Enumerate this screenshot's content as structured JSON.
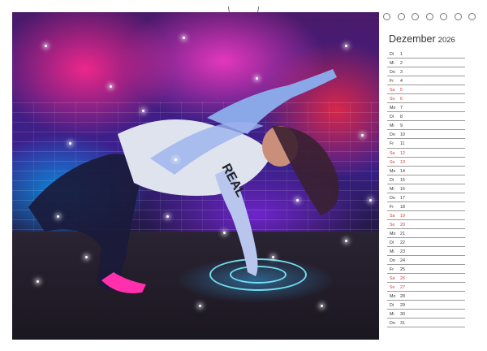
{
  "calendar": {
    "month": "Dezember",
    "year": "2026",
    "days": [
      {
        "wd": "Di",
        "d": "1",
        "weekend": false
      },
      {
        "wd": "Mi",
        "d": "2",
        "weekend": false
      },
      {
        "wd": "Do",
        "d": "3",
        "weekend": false
      },
      {
        "wd": "Fr",
        "d": "4",
        "weekend": false
      },
      {
        "wd": "Sa",
        "d": "5",
        "weekend": true
      },
      {
        "wd": "So",
        "d": "6",
        "weekend": true
      },
      {
        "wd": "Mo",
        "d": "7",
        "weekend": false
      },
      {
        "wd": "Di",
        "d": "8",
        "weekend": false
      },
      {
        "wd": "Mi",
        "d": "9",
        "weekend": false
      },
      {
        "wd": "Do",
        "d": "10",
        "weekend": false
      },
      {
        "wd": "Fr",
        "d": "11",
        "weekend": false
      },
      {
        "wd": "Sa",
        "d": "12",
        "weekend": true
      },
      {
        "wd": "So",
        "d": "13",
        "weekend": true
      },
      {
        "wd": "Mo",
        "d": "14",
        "weekend": false
      },
      {
        "wd": "Di",
        "d": "15",
        "weekend": false
      },
      {
        "wd": "Mi",
        "d": "16",
        "weekend": false
      },
      {
        "wd": "Do",
        "d": "17",
        "weekend": false
      },
      {
        "wd": "Fr",
        "d": "18",
        "weekend": false
      },
      {
        "wd": "Sa",
        "d": "19",
        "weekend": true
      },
      {
        "wd": "So",
        "d": "20",
        "weekend": true
      },
      {
        "wd": "Mo",
        "d": "21",
        "weekend": false
      },
      {
        "wd": "Di",
        "d": "22",
        "weekend": false
      },
      {
        "wd": "Mi",
        "d": "23",
        "weekend": false
      },
      {
        "wd": "Do",
        "d": "24",
        "weekend": false
      },
      {
        "wd": "Fr",
        "d": "25",
        "weekend": false
      },
      {
        "wd": "Sa",
        "d": "26",
        "weekend": true
      },
      {
        "wd": "So",
        "d": "27",
        "weekend": true
      },
      {
        "wd": "Mo",
        "d": "28",
        "weekend": false
      },
      {
        "wd": "Di",
        "d": "29",
        "weekend": false
      },
      {
        "wd": "Mi",
        "d": "30",
        "weekend": false
      },
      {
        "wd": "Do",
        "d": "31",
        "weekend": false
      }
    ]
  },
  "photo": {
    "shirt_lettering": "REAL"
  },
  "colors": {
    "weekend": "#d23b3b",
    "text": "#333333",
    "rule": "#9a9a9a"
  }
}
